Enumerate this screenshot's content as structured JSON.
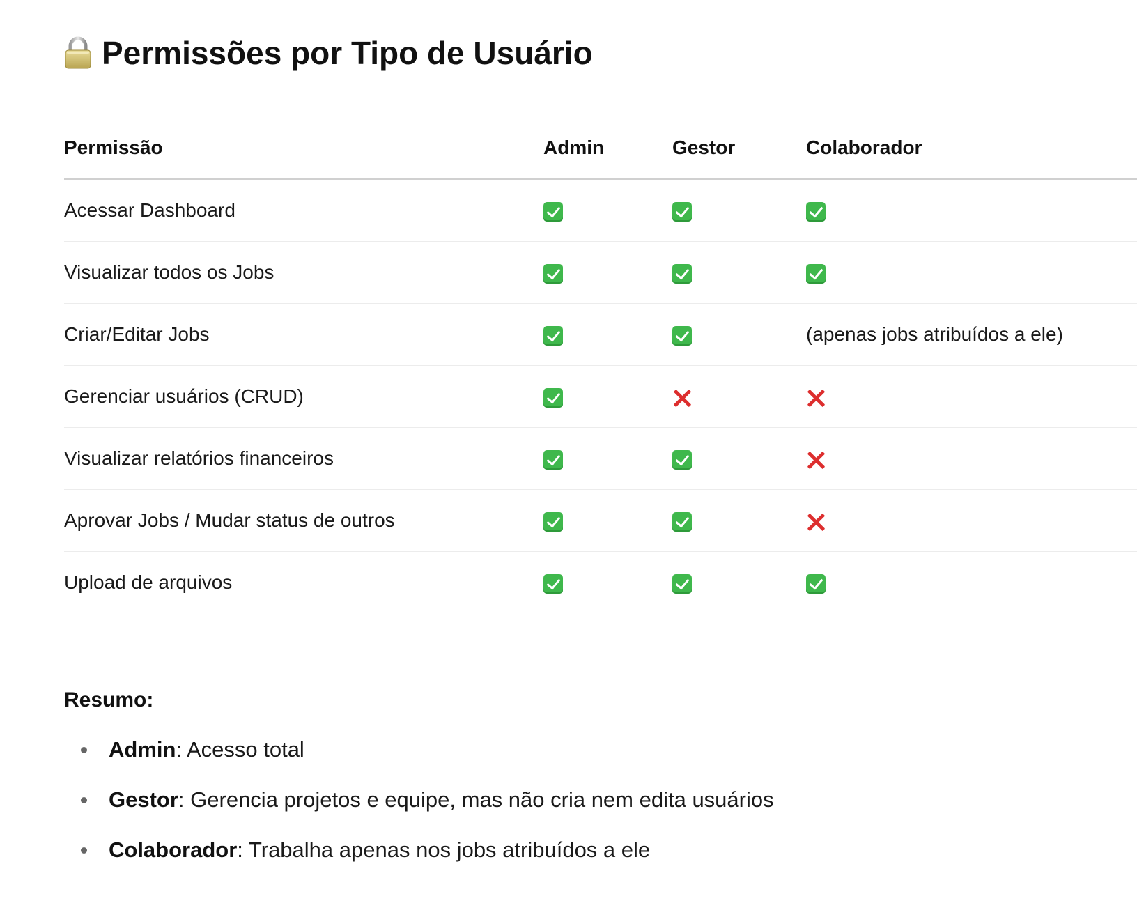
{
  "title": {
    "icon": "lock-icon",
    "text": "Permissões por Tipo de Usuário"
  },
  "table": {
    "headers": [
      "Permissão",
      "Admin",
      "Gestor",
      "Colaborador"
    ],
    "rows": [
      {
        "permission": "Acessar Dashboard",
        "admin": "yes",
        "gestor": "yes",
        "colaborador": "yes"
      },
      {
        "permission": "Visualizar todos os Jobs",
        "admin": "yes",
        "gestor": "yes",
        "colaborador": "yes"
      },
      {
        "permission": "Criar/Editar Jobs",
        "admin": "yes",
        "gestor": "yes",
        "colaborador": "(apenas jobs atribuídos a ele)"
      },
      {
        "permission": "Gerenciar usuários (CRUD)",
        "admin": "yes",
        "gestor": "no",
        "colaborador": "no"
      },
      {
        "permission": "Visualizar relatórios financeiros",
        "admin": "yes",
        "gestor": "yes",
        "colaborador": "no"
      },
      {
        "permission": "Aprovar Jobs / Mudar status de outros",
        "admin": "yes",
        "gestor": "yes",
        "colaborador": "no"
      },
      {
        "permission": "Upload de arquivos",
        "admin": "yes",
        "gestor": "yes",
        "colaborador": "yes"
      }
    ],
    "mark_icons": {
      "yes": "check-mark-button-icon",
      "no": "cross-mark-icon"
    },
    "colors": {
      "yes": "#3fb84c",
      "no": "#dd2e2e"
    }
  },
  "summary": {
    "title": "Resumo:",
    "items": [
      {
        "role": "Admin",
        "text": ": Acesso total"
      },
      {
        "role": "Gestor",
        "text": ": Gerencia projetos e equipe, mas não cria nem edita usuários"
      },
      {
        "role": "Colaborador",
        "text": ": Trabalha apenas nos jobs atribuídos a ele"
      }
    ]
  }
}
